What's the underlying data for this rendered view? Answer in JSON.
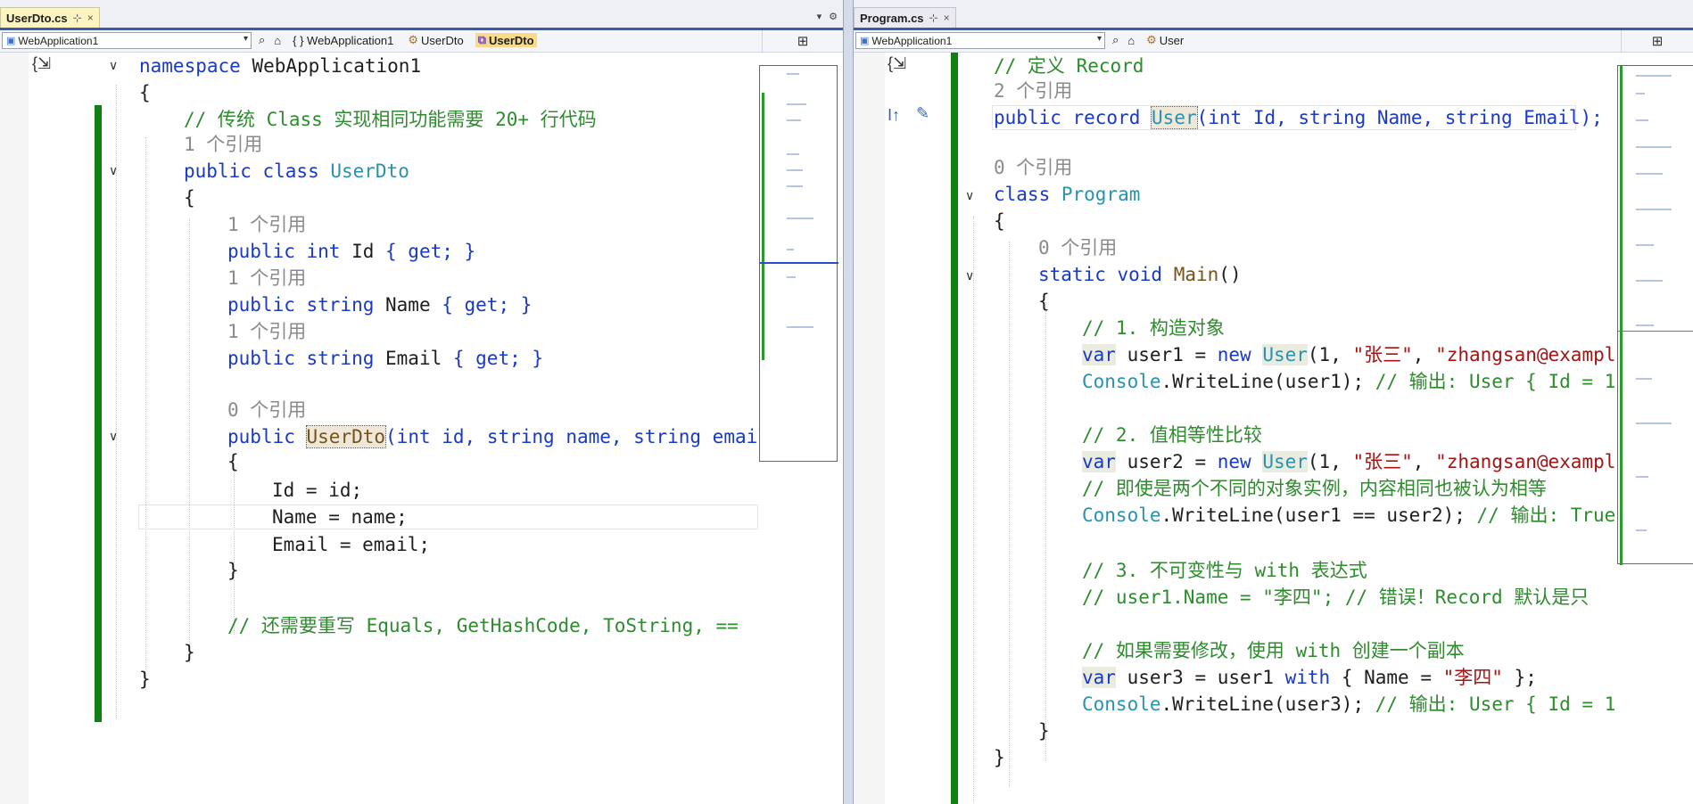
{
  "left_tab": {
    "title": "UserDto.cs",
    "pin": "⊹",
    "close": "×"
  },
  "right_tab": {
    "title": "Program.cs",
    "pin": "⊹",
    "close": "×"
  },
  "left_nav": {
    "project": "WebApplication1",
    "crumbs": [
      "{ } WebApplication1",
      "UserDto",
      "UserDto"
    ]
  },
  "right_nav": {
    "project": "WebApplication1",
    "crumbs": [
      "User"
    ]
  },
  "left_code": {
    "l1_kw": "namespace",
    "l1_name": " WebApplication1",
    "l2": "{",
    "l3": "// 传统 Class 实现相同功能需要 20+ 行代码",
    "l4": "1 个引用",
    "l5_kw": "public class",
    "l5_name": " UserDto",
    "l6": "{",
    "l7": "1 个引用",
    "l8_kw": "public int",
    "l8_name": " Id",
    "l8_rest": " { get; }",
    "l9": "1 个引用",
    "l10_kw": "public string",
    "l10_name": " Name",
    "l10_rest": " { get; }",
    "l11": "1 个引用",
    "l12_kw": "public string",
    "l12_name": " Email",
    "l12_rest": " { get; }",
    "l13": "0 个引用",
    "l14_kw": "public",
    "l14_name": "UserDto",
    "l14_rest": "(int id, string name, string email",
    "l15": "{",
    "l16": "Id = id;",
    "l17": "Name = name;",
    "l18": "Email = email;",
    "l19": "}",
    "l20": "// 还需要重写 Equals, GetHashCode, ToString, ==",
    "l21": "}",
    "l22": "}"
  },
  "right_code": {
    "r1": "// 定义 Record",
    "r2": "2 个引用",
    "r3_kw": "public record",
    "r3_name": "User",
    "r3_rest": "(int Id, string Name, string Email);",
    "r4": "0 个引用",
    "r5_kw": "class",
    "r5_name": " Program",
    "r6": "{",
    "r7": "0 个引用",
    "r8_kw": "static void",
    "r8_name": " Main",
    "r8_rest": "()",
    "r9": "{",
    "r10": "// 1. 构造对象",
    "r11_a": "var",
    "r11_b": " user1 = ",
    "r11_c": "new",
    "r11_d": "User",
    "r11_e": "(1, ",
    "r11_f": "\"张三\"",
    "r11_g": ", ",
    "r11_h": "\"zhangsan@exampl",
    "r12_a": "Console",
    "r12_b": ".WriteLine(user1); ",
    "r12_c": "// 输出: User { Id = 1",
    "r13": "// 2. 值相等性比较",
    "r14_a": "var",
    "r14_b": " user2 = ",
    "r14_c": "new",
    "r14_d": "User",
    "r14_e": "(1, ",
    "r14_f": "\"张三\"",
    "r14_g": ", ",
    "r14_h": "\"zhangsan@exampl",
    "r15": "// 即使是两个不同的对象实例，内容相同也被认为相等",
    "r16_a": "Console",
    "r16_b": ".WriteLine(user1 == user2); ",
    "r16_c": "// 输出: True",
    "r17": "// 3. 不可变性与 with 表达式",
    "r18": "// user1.Name = \"李四\"; // 错误！Record 默认是只",
    "r19": "// 如果需要修改，使用 with 创建一个副本",
    "r20_a": "var",
    "r20_b": " user3 = user1 ",
    "r20_c": "with",
    "r20_d": " { Name = ",
    "r20_e": "\"李四\"",
    "r20_f": " };",
    "r21_a": "Console",
    "r21_b": ".WriteLine(user3); ",
    "r21_c": "// 输出: User { Id = 1",
    "r22": "}",
    "r23": "}"
  },
  "icons": {
    "brace_icon": "{",
    "split_icon": "⊞",
    "dropdown": "▾",
    "settings": "⚙"
  }
}
